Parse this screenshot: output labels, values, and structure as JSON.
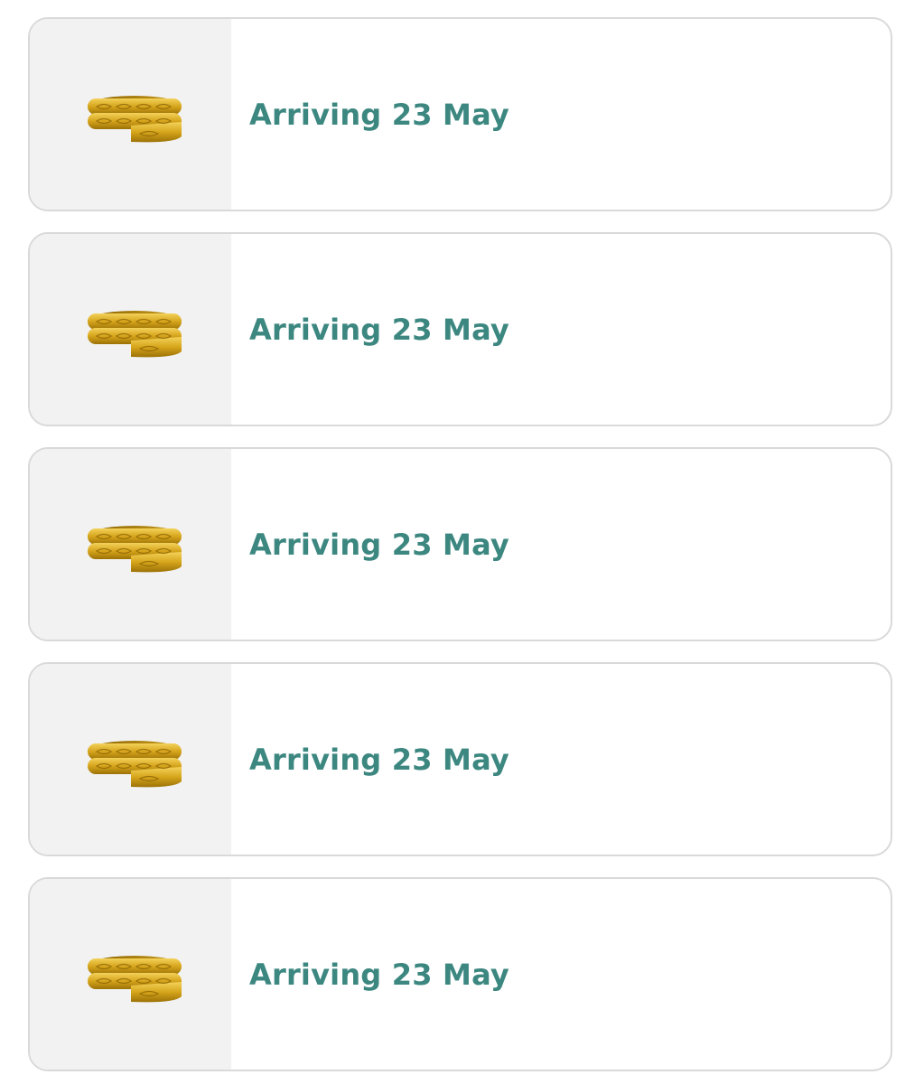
{
  "theme": {
    "status_color": "#3c8780",
    "thumb_bg": "#f2f2f2",
    "card_border": "#d9d9d9",
    "gold": "#d4a61c"
  },
  "orders": [
    {
      "status": "Arriving 23 May",
      "image_icon": "gold-spiral-ring-icon"
    },
    {
      "status": "Arriving 23 May",
      "image_icon": "gold-spiral-ring-icon"
    },
    {
      "status": "Arriving 23 May",
      "image_icon": "gold-spiral-ring-icon"
    },
    {
      "status": "Arriving 23 May",
      "image_icon": "gold-spiral-ring-icon"
    },
    {
      "status": "Arriving 23 May",
      "image_icon": "gold-spiral-ring-icon"
    }
  ]
}
